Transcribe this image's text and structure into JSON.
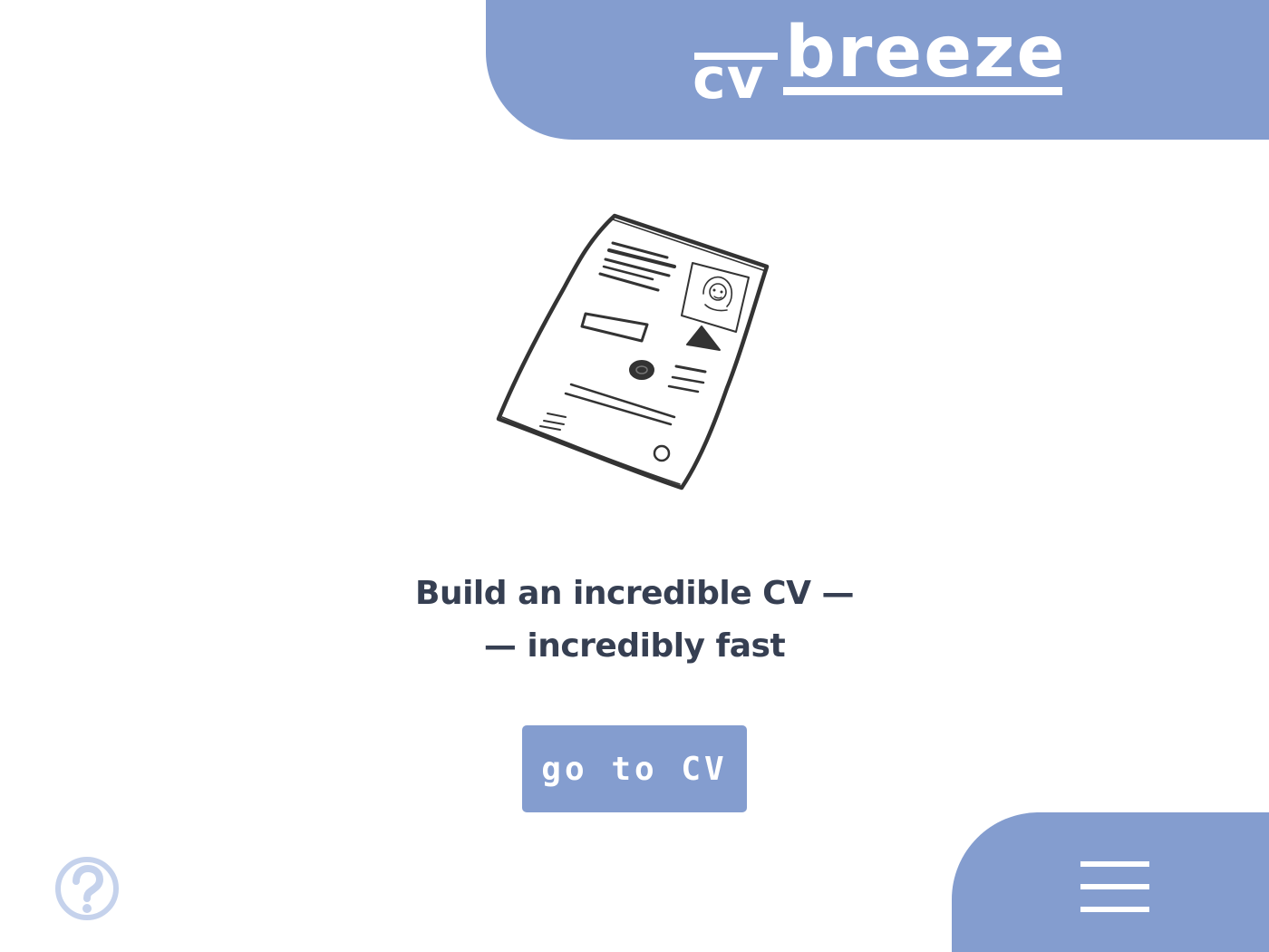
{
  "header": {
    "logo_cv": "cv",
    "logo_breeze": "breeze"
  },
  "hero": {
    "illustration_icon": "cv-document-sketch-icon",
    "headline_line1": "Build an incredible CV —",
    "headline_line2": "— incredibly fast",
    "cta_label": "go to CV"
  },
  "footer": {
    "help_icon": "question-circle-icon",
    "menu_icon": "hamburger-menu-icon"
  },
  "colors": {
    "accent": "#849dcf",
    "help_icon": "#c5d2ec",
    "text": "#363f52",
    "background": "#ffffff"
  }
}
